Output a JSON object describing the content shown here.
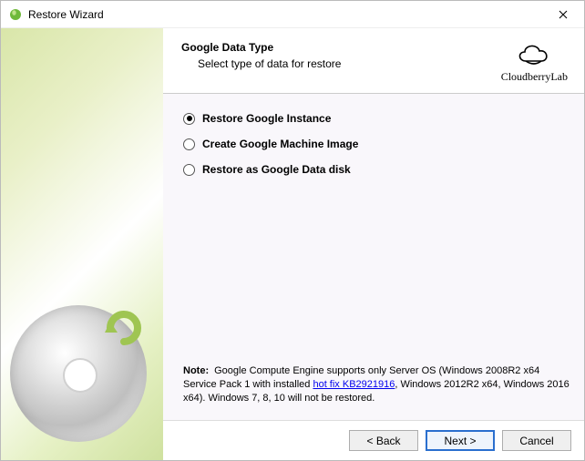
{
  "window": {
    "title": "Restore Wizard"
  },
  "header": {
    "heading": "Google Data Type",
    "subheading": "Select type of data for restore",
    "brand": "CloudberryLab"
  },
  "options": [
    {
      "label": "Restore Google Instance",
      "selected": true
    },
    {
      "label": "Create Google Machine Image",
      "selected": false
    },
    {
      "label": "Restore as Google Data disk",
      "selected": false
    }
  ],
  "note": {
    "label": "Note:",
    "pre": "Google Compute Engine supports only Server OS (Windows 2008R2 x64 Service Pack 1 with installed ",
    "link": "hot fix KB2921916",
    "post": ", Windows 2012R2 x64, Windows 2016 x64). Windows 7, 8, 10 will not be restored."
  },
  "footer": {
    "back": "< Back",
    "next": "Next >",
    "cancel": "Cancel"
  }
}
